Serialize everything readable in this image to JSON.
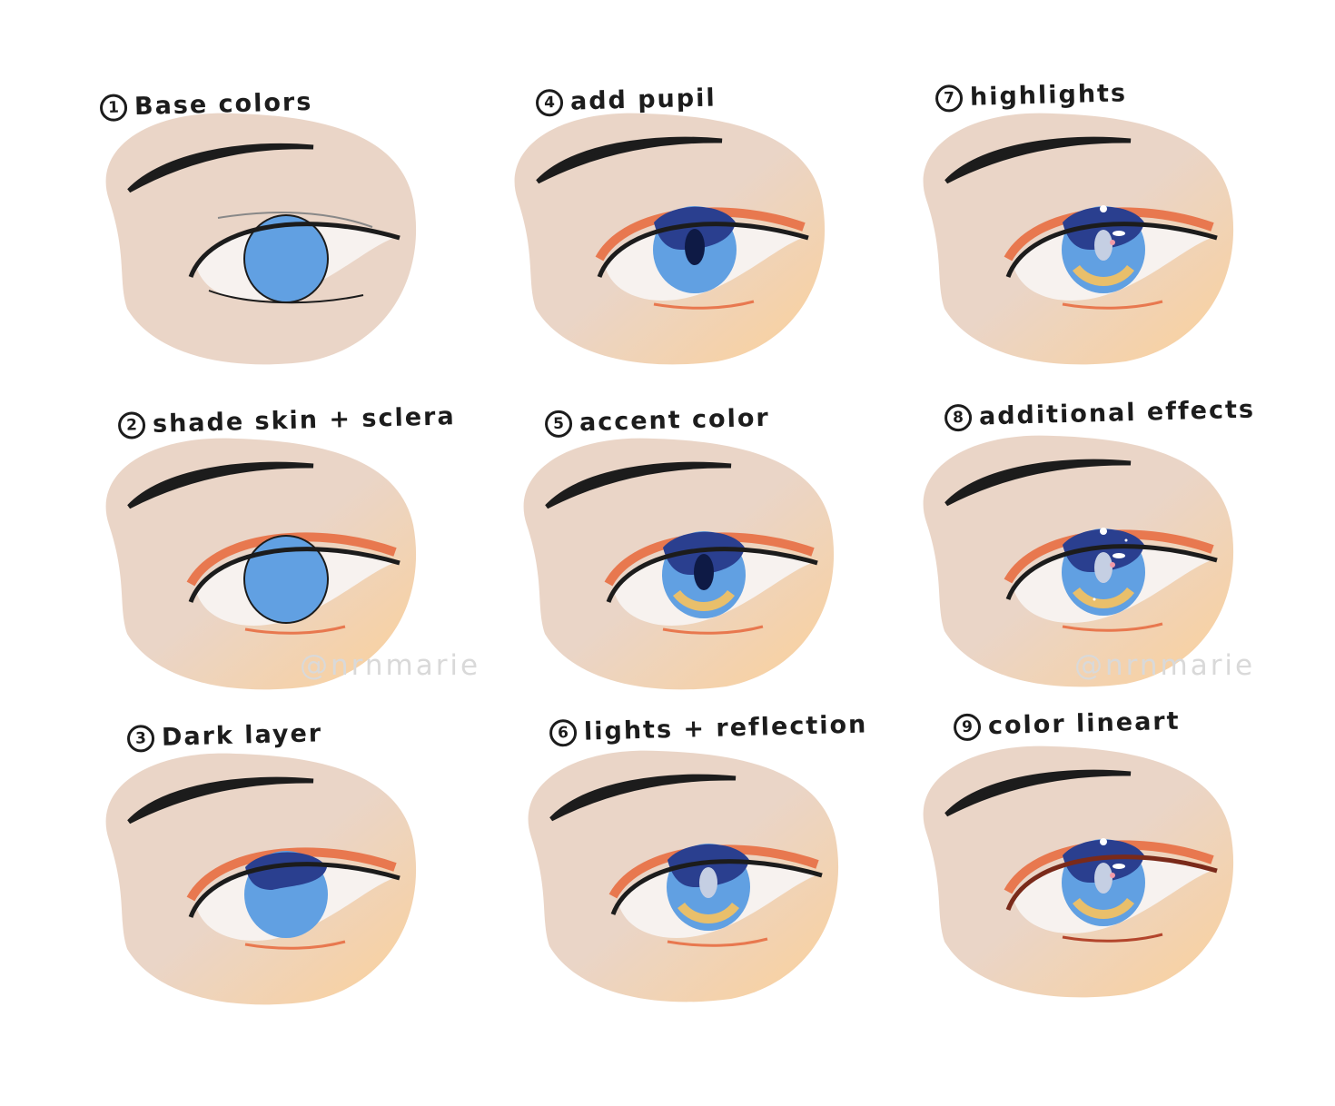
{
  "steps": [
    {
      "number": "1",
      "label": "Base colors"
    },
    {
      "number": "2",
      "label": "shade skin + sclera"
    },
    {
      "number": "3",
      "label": "Dark layer"
    },
    {
      "number": "4",
      "label": "add pupil"
    },
    {
      "number": "5",
      "label": "accent color"
    },
    {
      "number": "6",
      "label": "lights + reflection"
    },
    {
      "number": "7",
      "label": "highlights"
    },
    {
      "number": "8",
      "label": "additional effects"
    },
    {
      "number": "9",
      "label": "color lineart"
    }
  ],
  "watermark": "@nrnmarie",
  "colors": {
    "skin": "#ead5c7",
    "skin_warm": "#fbd09a",
    "shadow": "#e8784f",
    "sclera": "#f7f2ef",
    "iris_base": "#61a0e2",
    "iris_dark": "#2a3f8f",
    "accent": "#e9bf6b",
    "line": "#1c1c1c"
  }
}
